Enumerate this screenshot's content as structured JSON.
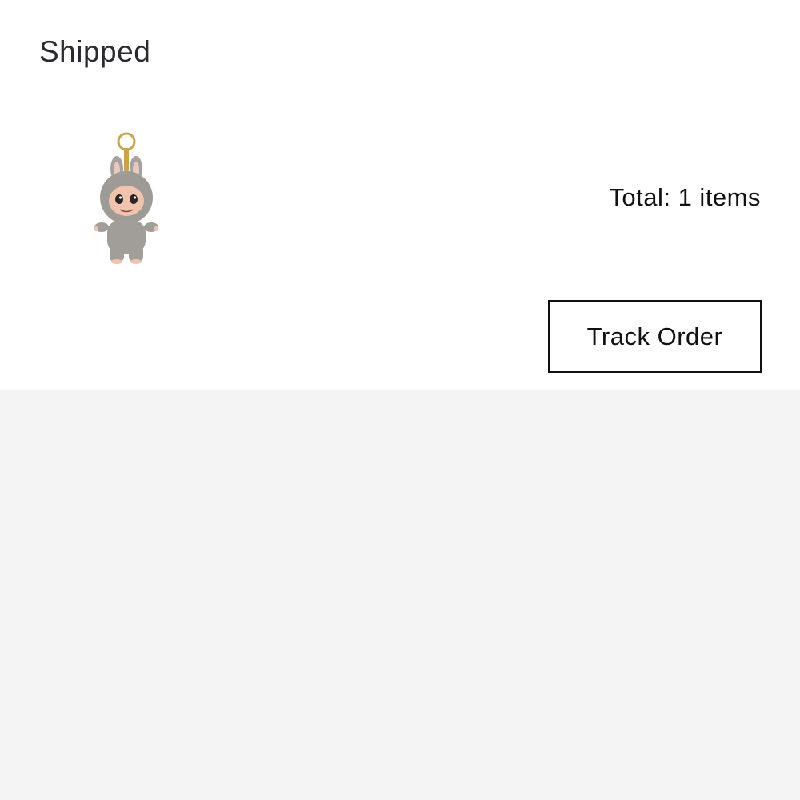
{
  "order": {
    "status": "Shipped",
    "product_image": "labubu-plush-keychain",
    "total_text": "Total: 1 items",
    "track_button_label": "Track Order"
  },
  "colors": {
    "card_background": "#ffffff",
    "page_background": "#f4f4f4",
    "text_primary": "#111111",
    "button_border": "#111111"
  }
}
